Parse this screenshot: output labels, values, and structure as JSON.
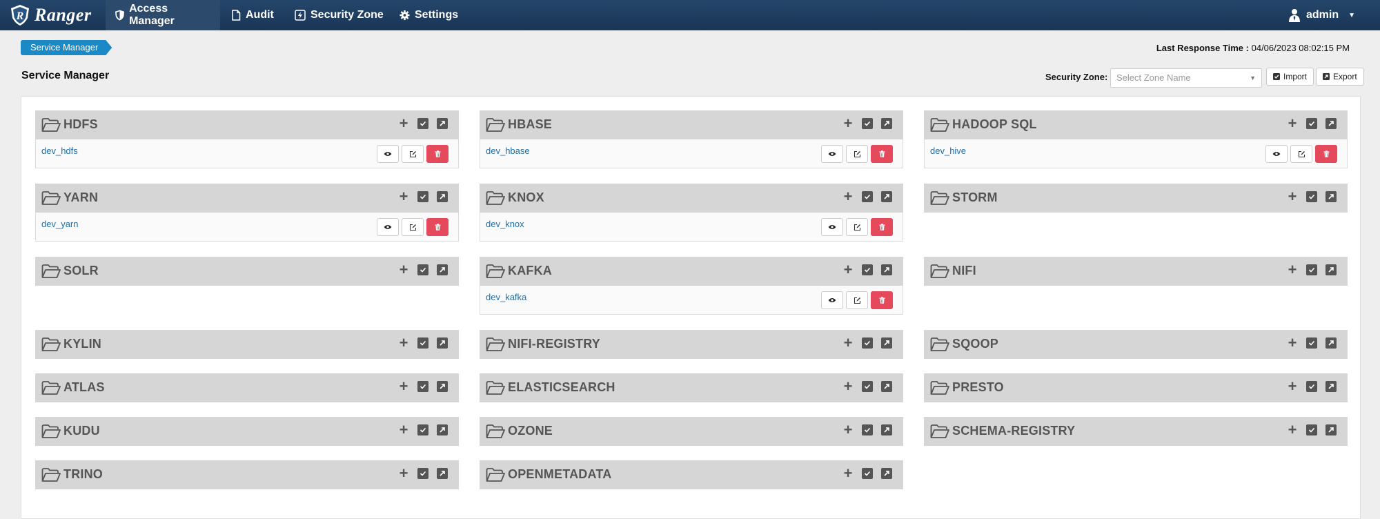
{
  "navbar": {
    "brand": "Ranger",
    "items": [
      {
        "label": "Access Manager",
        "active": true,
        "icon": "shield-icon"
      },
      {
        "label": "Audit",
        "active": false,
        "icon": "file-icon"
      },
      {
        "label": "Security Zone",
        "active": false,
        "icon": "bolt-icon"
      },
      {
        "label": "Settings",
        "active": false,
        "icon": "gear-icon"
      }
    ],
    "user": "admin"
  },
  "breadcrumb": "Service Manager",
  "last_response_label": "Last Response Time :",
  "last_response_value": "04/06/2023 08:02:15 PM",
  "page_title": "Service Manager",
  "security_zone": {
    "label": "Security Zone:",
    "placeholder": "Select Zone Name"
  },
  "toolbar": {
    "import_label": "Import",
    "export_label": "Export"
  },
  "services": [
    {
      "name": "HDFS",
      "repos": [
        "dev_hdfs"
      ]
    },
    {
      "name": "HBASE",
      "repos": [
        "dev_hbase"
      ]
    },
    {
      "name": "HADOOP SQL",
      "repos": [
        "dev_hive"
      ]
    },
    {
      "name": "YARN",
      "repos": [
        "dev_yarn"
      ]
    },
    {
      "name": "KNOX",
      "repos": [
        "dev_knox"
      ]
    },
    {
      "name": "STORM",
      "repos": []
    },
    {
      "name": "SOLR",
      "repos": []
    },
    {
      "name": "KAFKA",
      "repos": [
        "dev_kafka"
      ]
    },
    {
      "name": "NIFI",
      "repos": []
    },
    {
      "name": "KYLIN",
      "repos": []
    },
    {
      "name": "NIFI-REGISTRY",
      "repos": []
    },
    {
      "name": "SQOOP",
      "repos": []
    },
    {
      "name": "ATLAS",
      "repos": []
    },
    {
      "name": "ELASTICSEARCH",
      "repos": []
    },
    {
      "name": "PRESTO",
      "repos": []
    },
    {
      "name": "KUDU",
      "repos": []
    },
    {
      "name": "OZONE",
      "repos": []
    },
    {
      "name": "SCHEMA-REGISTRY",
      "repos": []
    },
    {
      "name": "TRINO",
      "repos": []
    },
    {
      "name": "OPENMETADATA",
      "repos": []
    }
  ],
  "colors": {
    "navbar": "#1a3556",
    "breadcrumb": "#1b89c6",
    "delete": "#e5495c",
    "link": "#1f6fa6",
    "service_header": "#d6d6d6"
  }
}
